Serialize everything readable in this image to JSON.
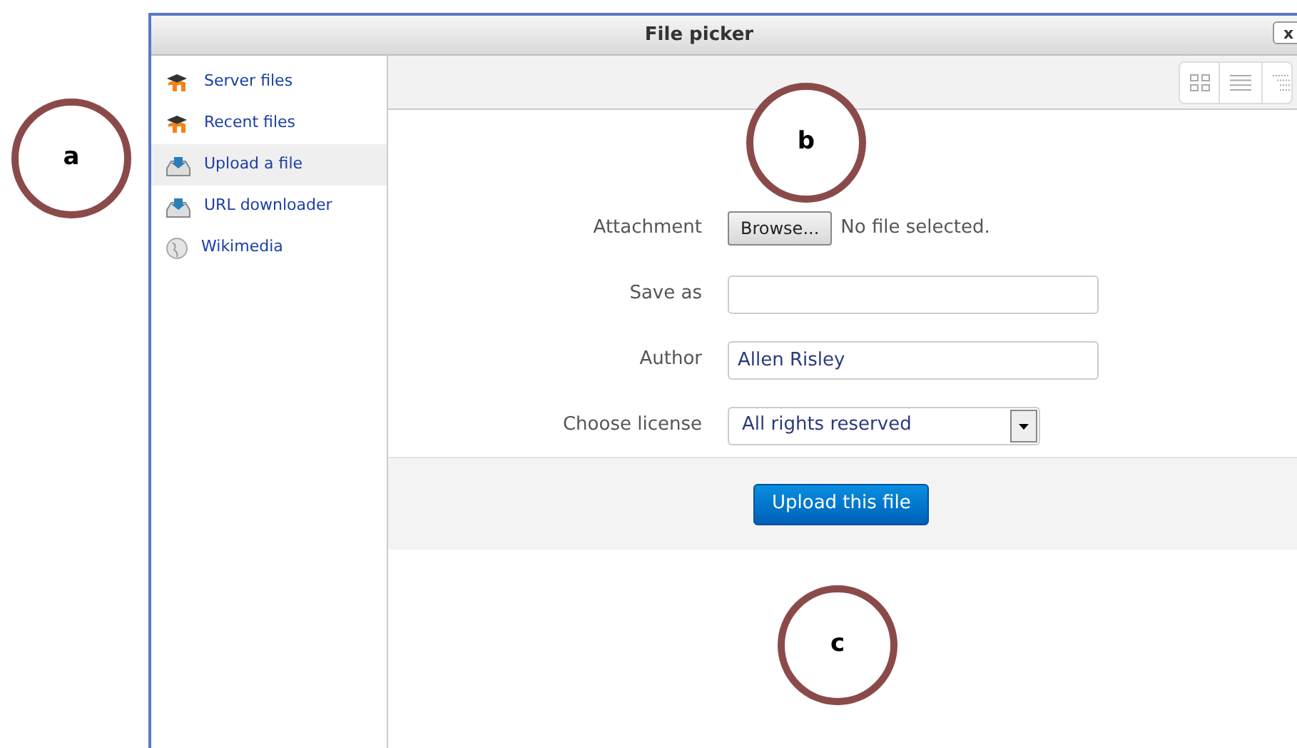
{
  "window": {
    "title": "File picker",
    "close": "x"
  },
  "sidebar": {
    "items": [
      {
        "label": "Server files",
        "kind": "moodle",
        "selected": false
      },
      {
        "label": "Recent files",
        "kind": "moodle",
        "selected": false
      },
      {
        "label": "Upload a file",
        "kind": "upload",
        "selected": true
      },
      {
        "label": "URL downloader",
        "kind": "upload",
        "selected": false
      },
      {
        "label": "Wikimedia",
        "kind": "globe",
        "selected": false
      }
    ]
  },
  "form": {
    "attachment_label": "Attachment",
    "browse": "Browse...",
    "file_status": "No file selected.",
    "save_as_label": "Save as",
    "author_label": "Author",
    "author_value": "Allen Risley",
    "license_label": "Choose license",
    "license_value": "All rights reserved",
    "submit": "Upload this file"
  },
  "callouts": [
    "a",
    "b",
    "c"
  ]
}
